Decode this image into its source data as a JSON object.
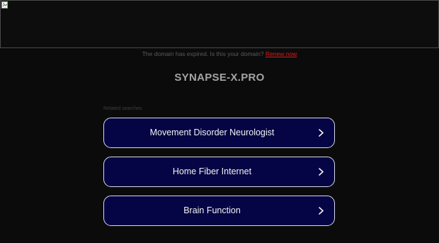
{
  "banner": {
    "image_icon": "broken-image-icon"
  },
  "notice": {
    "text": "The domain has expired. Is this your domain?",
    "renew_label": "Renew now"
  },
  "domain": {
    "title": "SYNAPSE-X.PRO"
  },
  "related": {
    "label": "Related searches",
    "items": [
      {
        "label": "Movement Disorder Neurologist",
        "icon": "chevron-right-icon"
      },
      {
        "label": "Home Fiber Internet",
        "icon": "chevron-right-icon"
      },
      {
        "label": "Brain Function",
        "icon": "chevron-right-icon"
      }
    ]
  },
  "colors": {
    "background": "#0b0b0b",
    "button_bg": "#050545",
    "button_border": "#d8d8e8",
    "renew_link": "#e01b1b",
    "title": "#a4a4a4"
  }
}
